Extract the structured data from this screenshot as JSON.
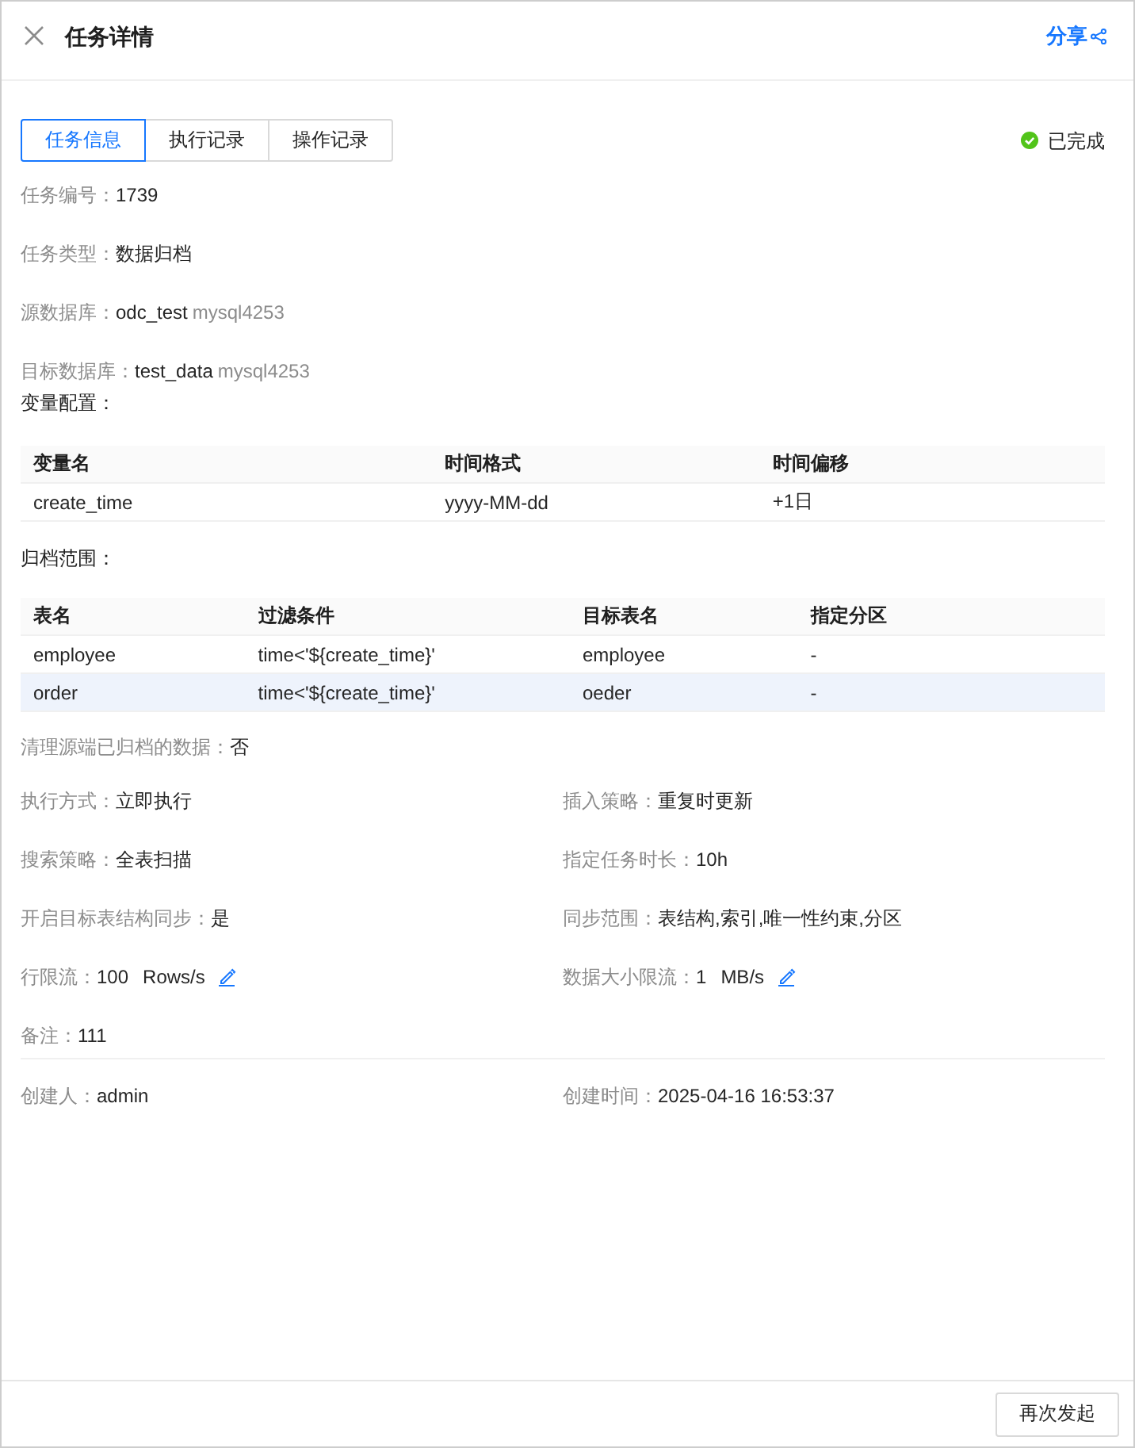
{
  "header": {
    "title": "任务详情",
    "share_label": "分享"
  },
  "tabs": [
    {
      "label": "任务信息",
      "selected": true
    },
    {
      "label": "执行记录",
      "selected": false
    },
    {
      "label": "操作记录",
      "selected": false
    }
  ],
  "status": {
    "label": "已完成",
    "kind": "success"
  },
  "basic_info": [
    {
      "label": "任务编号：",
      "value": "1739"
    },
    {
      "label": "任务类型：",
      "value": "数据归档"
    },
    {
      "label": "源数据库：",
      "value": "odc_test",
      "instance": "mysql4253"
    },
    {
      "label": "目标数据库：",
      "value": "test_data",
      "instance": "mysql4253"
    }
  ],
  "variables": {
    "title": "变量配置：",
    "columns": [
      "变量名",
      "时间格式",
      "时间偏移"
    ],
    "rows": [
      {
        "cells": [
          "create_time",
          "yyyy-MM-dd",
          "+1日"
        ]
      }
    ]
  },
  "archive_range": {
    "title": "归档范围：",
    "columns": [
      "表名",
      "过滤条件",
      "目标表名",
      "指定分区"
    ],
    "rows": [
      {
        "cells": [
          "employee",
          "time<'${create_time}'",
          "employee",
          "-"
        ],
        "selected": false
      },
      {
        "cells": [
          "order",
          "time<'${create_time}'",
          "oeder",
          "-"
        ],
        "selected": true
      }
    ]
  },
  "cleanup": {
    "label": "清理源端已归档的数据：",
    "value": "否"
  },
  "settings": [
    {
      "label": "执行方式：",
      "value": "立即执行"
    },
    {
      "label": "插入策略：",
      "value": "重复时更新"
    },
    {
      "label": "搜索策略：",
      "value": "全表扫描"
    },
    {
      "label": "指定任务时长：",
      "value": "10h"
    },
    {
      "label": "开启目标表结构同步：",
      "value": "是"
    },
    {
      "label": "同步范围：",
      "value": "表结构,索引,唯一性约束,分区"
    },
    {
      "label": "行限流：",
      "value": "100",
      "unit": "Rows/s",
      "editable": true
    },
    {
      "label": "数据大小限流：",
      "value": "1",
      "unit": "MB/s",
      "editable": true
    }
  ],
  "remark": {
    "label": "备注：",
    "value": "111"
  },
  "footer_info": [
    {
      "label": "创建人：",
      "value": "admin"
    },
    {
      "label": "创建时间：",
      "value": "2025-04-16 16:53:37"
    }
  ],
  "actions": [
    {
      "label": "再次发起"
    }
  ]
}
